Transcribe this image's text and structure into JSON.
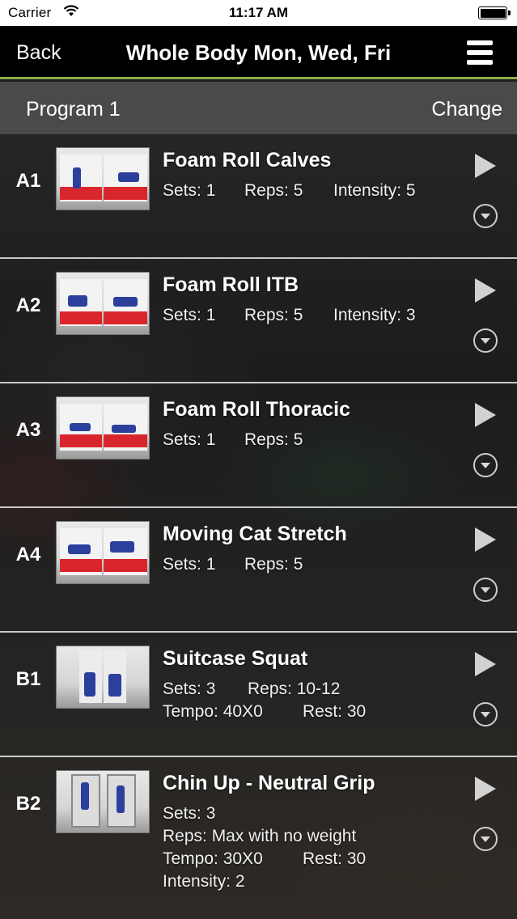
{
  "status_bar": {
    "carrier": "Carrier",
    "time": "11:17 AM"
  },
  "nav": {
    "back_label": "Back",
    "title": "Whole Body Mon, Wed, Fri",
    "menu_icon": "hamburger-menu-icon"
  },
  "program_bar": {
    "program": "Program 1",
    "change_label": "Change"
  },
  "exercises": [
    {
      "code": "A1",
      "name": "Foam Roll Calves",
      "lines": [
        [
          "Sets: 1",
          "Reps: 5",
          "Intensity: 5"
        ]
      ]
    },
    {
      "code": "A2",
      "name": "Foam Roll ITB",
      "lines": [
        [
          "Sets: 1",
          "Reps: 5",
          "Intensity: 3"
        ]
      ]
    },
    {
      "code": "A3",
      "name": "Foam Roll Thoracic",
      "lines": [
        [
          "Sets: 1",
          "Reps: 5"
        ]
      ]
    },
    {
      "code": "A4",
      "name": "Moving Cat Stretch",
      "lines": [
        [
          "Sets: 1",
          "Reps: 5"
        ]
      ]
    },
    {
      "code": "B1",
      "name": "Suitcase Squat",
      "lines": [
        [
          "Sets: 3",
          "Reps: 10-12"
        ],
        [
          "Tempo: 40X0",
          "Rest: 30"
        ]
      ]
    },
    {
      "code": "B2",
      "name": "Chin Up - Neutral Grip",
      "lines": [
        [
          "Sets: 3"
        ],
        [
          "Reps: Max with no weight"
        ],
        [
          "Tempo: 30X0",
          "Rest: 30"
        ],
        [
          "Intensity: 2"
        ]
      ]
    }
  ],
  "colors": {
    "accent": "#8db043",
    "nav_bg": "#000000",
    "program_bar_bg": "#4a4a4a"
  }
}
